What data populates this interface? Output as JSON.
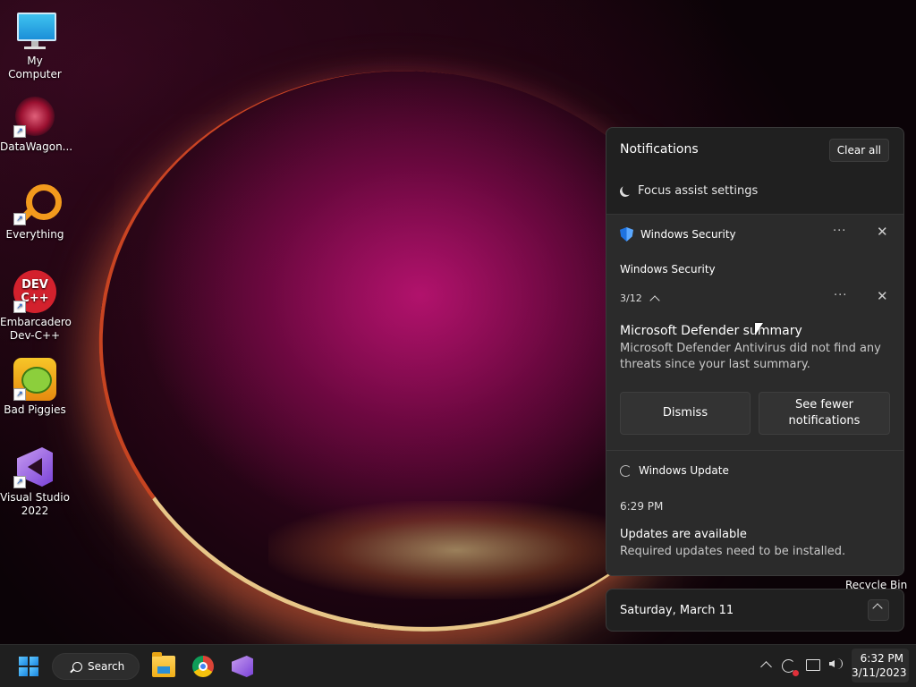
{
  "desktop": {
    "icons": [
      {
        "label": "My Computer",
        "icon": "monitor-icon"
      },
      {
        "label": "DataWagon...",
        "icon": "datawagon-icon"
      },
      {
        "label": "Everything",
        "icon": "everything-search-icon"
      },
      {
        "label": "Embarcadero Dev-C++",
        "icon": "devcpp-icon",
        "logo_text": "DEV C++"
      },
      {
        "label": "Bad Piggies",
        "icon": "bad-piggies-icon"
      },
      {
        "label": "Visual Studio 2022",
        "icon": "visual-studio-icon"
      }
    ],
    "recycle_bin_label": "Recycle Bin"
  },
  "notifications": {
    "header": "Notifications",
    "clear_all": "Clear all",
    "focus_assist": "Focus assist settings",
    "groups": [
      {
        "app": "Windows Security",
        "more": "···",
        "close": "✕",
        "sub_title": "Windows Security",
        "counter": "3/12",
        "title": "Microsoft Defender summary",
        "body": "Microsoft Defender Antivirus did not find any threats since your last summary.",
        "actions": [
          "Dismiss",
          "See fewer notifications"
        ]
      },
      {
        "app": "Windows Update",
        "time": "6:29 PM",
        "title": "Updates are available",
        "body": "Required updates need to be installed."
      }
    ]
  },
  "calendar": {
    "date": "Saturday, March 11"
  },
  "taskbar": {
    "search_label": "Search",
    "pinned": [
      "file-explorer-icon",
      "chrome-icon",
      "visual-studio-icon"
    ],
    "clock_time": "6:32 PM",
    "clock_date": "3/11/2023"
  },
  "colors": {
    "accent": "#1a86e0",
    "panel_bg": "#202020",
    "card_bg": "#2b2b2b"
  }
}
